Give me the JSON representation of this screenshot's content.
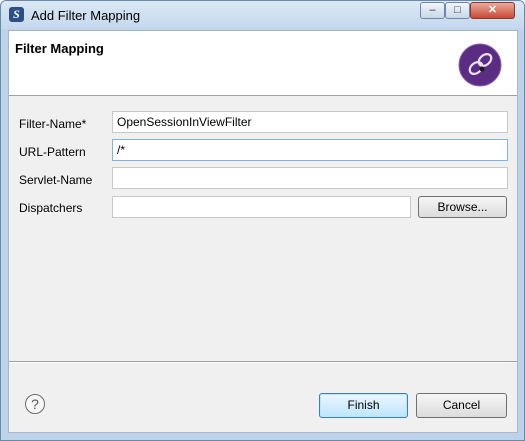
{
  "window": {
    "title": "Add Filter Mapping",
    "controls": {
      "minimize": "–",
      "maximize": "□",
      "close": "✕"
    }
  },
  "banner": {
    "title": "Filter Mapping",
    "logo": "spring-ide-logo"
  },
  "form": {
    "filter_name_label": "Filter-Name*",
    "filter_name_value": "OpenSessionInViewFilter",
    "url_pattern_label": "URL-Pattern",
    "url_pattern_value": "/*",
    "servlet_name_label": "Servlet-Name",
    "servlet_name_value": "",
    "dispatchers_label": "Dispatchers",
    "dispatchers_value": "",
    "browse_label": "Browse..."
  },
  "footer": {
    "help_icon": "help-icon",
    "help_glyph": "?",
    "finish_label": "Finish",
    "cancel_label": "Cancel"
  },
  "colors": {
    "accent": "#3c7fb1",
    "title_bar": "#c4d8ee",
    "close_button": "#c94a36",
    "logo_purple": "#5a2d82"
  }
}
